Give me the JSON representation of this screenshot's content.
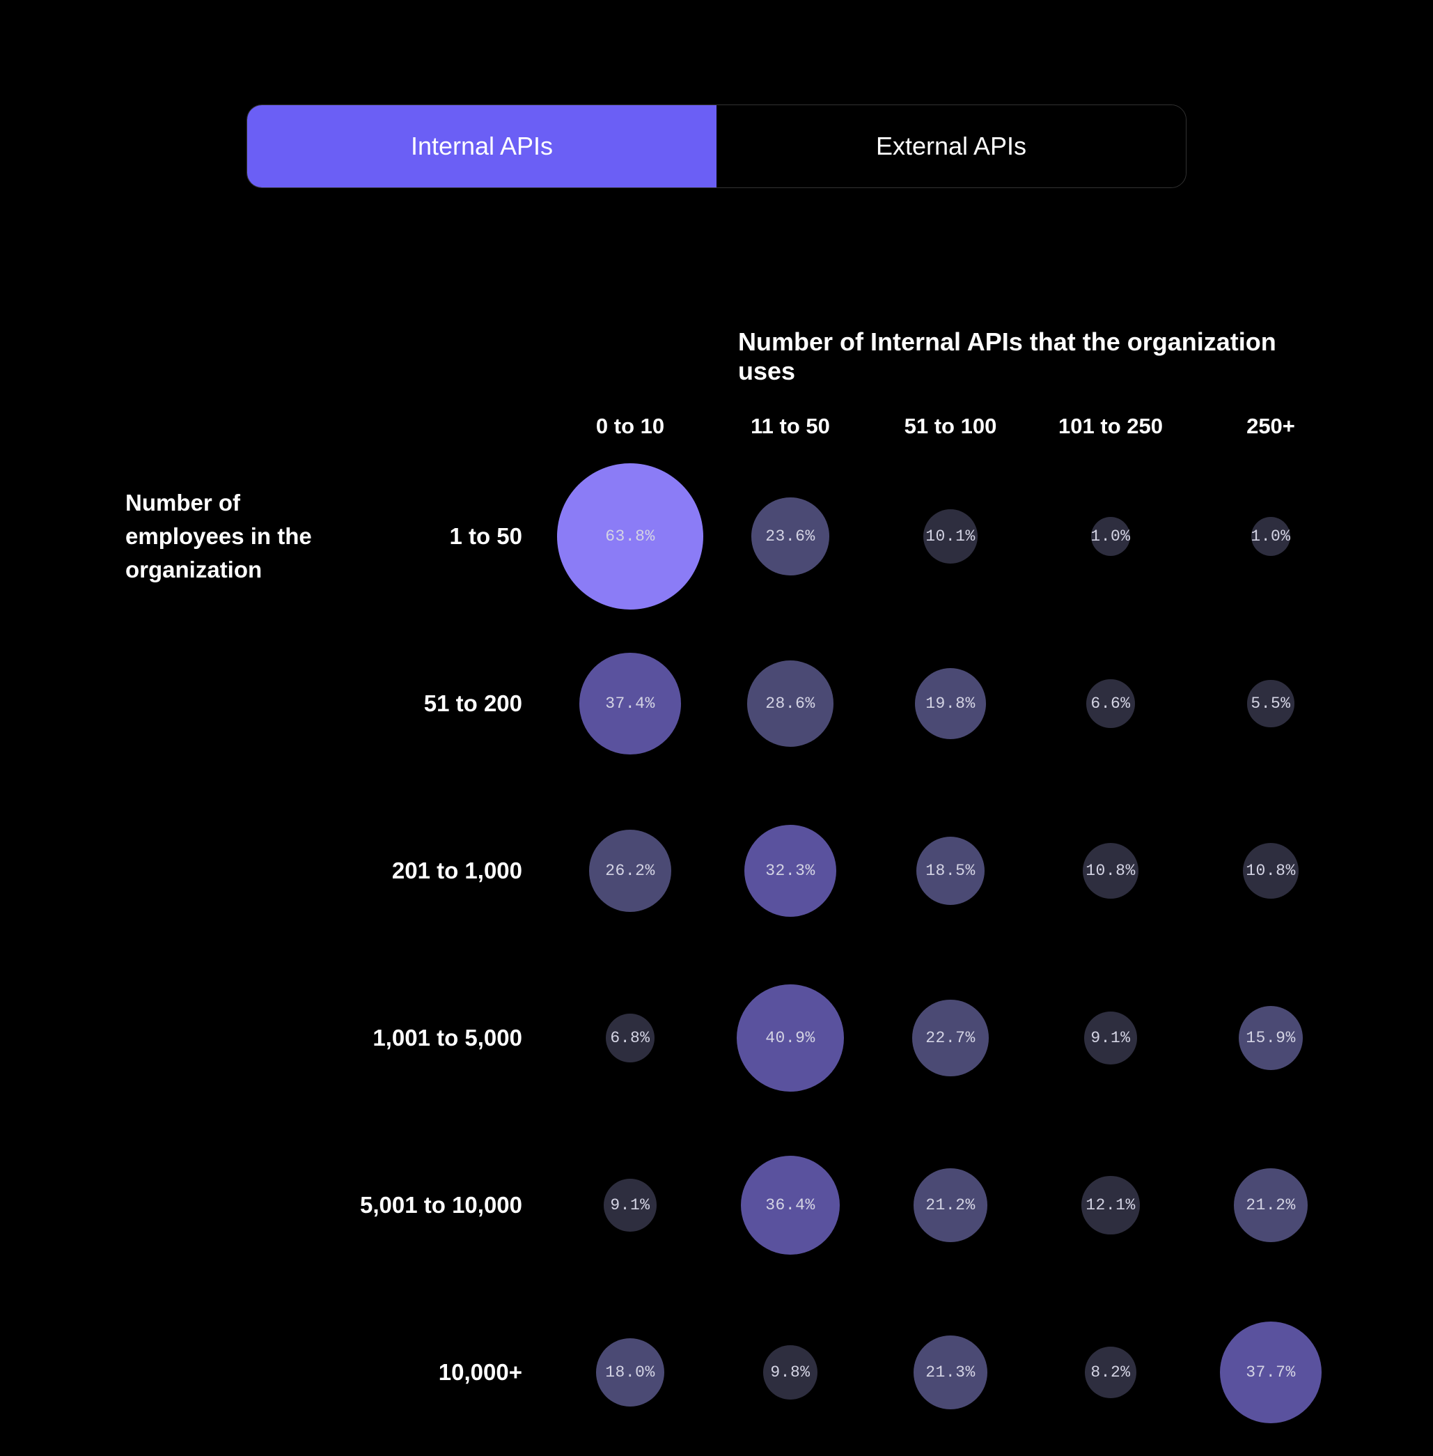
{
  "tabs": [
    {
      "label": "Internal APIs",
      "active": true
    },
    {
      "label": "External APIs",
      "active": false
    }
  ],
  "chart_data": {
    "type": "heatmap",
    "title": "Number of Internal APIs that the organization uses",
    "ylabel": "Number of employees in the organization",
    "x_categories": [
      "0 to 10",
      "11 to 50",
      "51 to 100",
      "101 to 250",
      "250+"
    ],
    "y_categories": [
      "1 to 50",
      "51 to 200",
      "201 to 1,000",
      "1,001 to 5,000",
      "5,001 to 10,000",
      "10,000+"
    ],
    "values": [
      [
        63.8,
        23.6,
        10.1,
        1.0,
        1.0
      ],
      [
        37.4,
        28.6,
        19.8,
        6.6,
        5.5
      ],
      [
        26.2,
        32.3,
        18.5,
        10.8,
        10.8
      ],
      [
        6.8,
        40.9,
        22.7,
        9.1,
        15.9
      ],
      [
        9.1,
        36.4,
        21.2,
        12.1,
        21.2
      ],
      [
        18.0,
        9.8,
        21.3,
        8.2,
        37.7
      ]
    ],
    "unit": "%"
  },
  "style": {
    "min_diameter": 56,
    "max_diameter": 210,
    "colors": {
      "low": "#2e2e3f",
      "mid": "#4b4a74",
      "high": "#5a529e",
      "highest": "#8b7cf6"
    }
  }
}
